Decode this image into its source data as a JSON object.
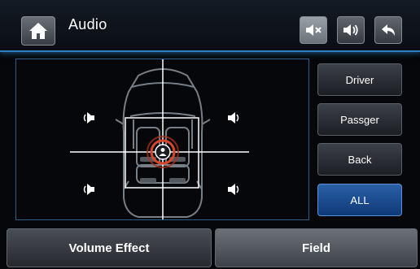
{
  "header": {
    "title": "Audio",
    "home_icon": "home-icon",
    "mute_icon": "mute-icon",
    "speaker_icon": "speaker-volume-icon",
    "back_icon": "back-arrow-icon"
  },
  "field_panel": {
    "car_icon": "car-top-view-icon",
    "speaker_icons": [
      "speaker-front-left-icon",
      "speaker-front-right-icon",
      "speaker-rear-left-icon",
      "speaker-rear-right-icon"
    ],
    "focus_icon": "listener-focus-icon"
  },
  "seat_buttons": [
    {
      "label": "Driver",
      "selected": false
    },
    {
      "label": "Passger",
      "selected": false
    },
    {
      "label": "Back",
      "selected": false
    },
    {
      "label": "ALL",
      "selected": true
    }
  ],
  "bottom_tabs": [
    {
      "label": "Volume Effect",
      "active": false
    },
    {
      "label": "Field",
      "active": true
    }
  ],
  "colors": {
    "accent_blue": "#2c7fc0",
    "selected_button": "#1f4f94",
    "focus_ring": "#d8452a"
  }
}
